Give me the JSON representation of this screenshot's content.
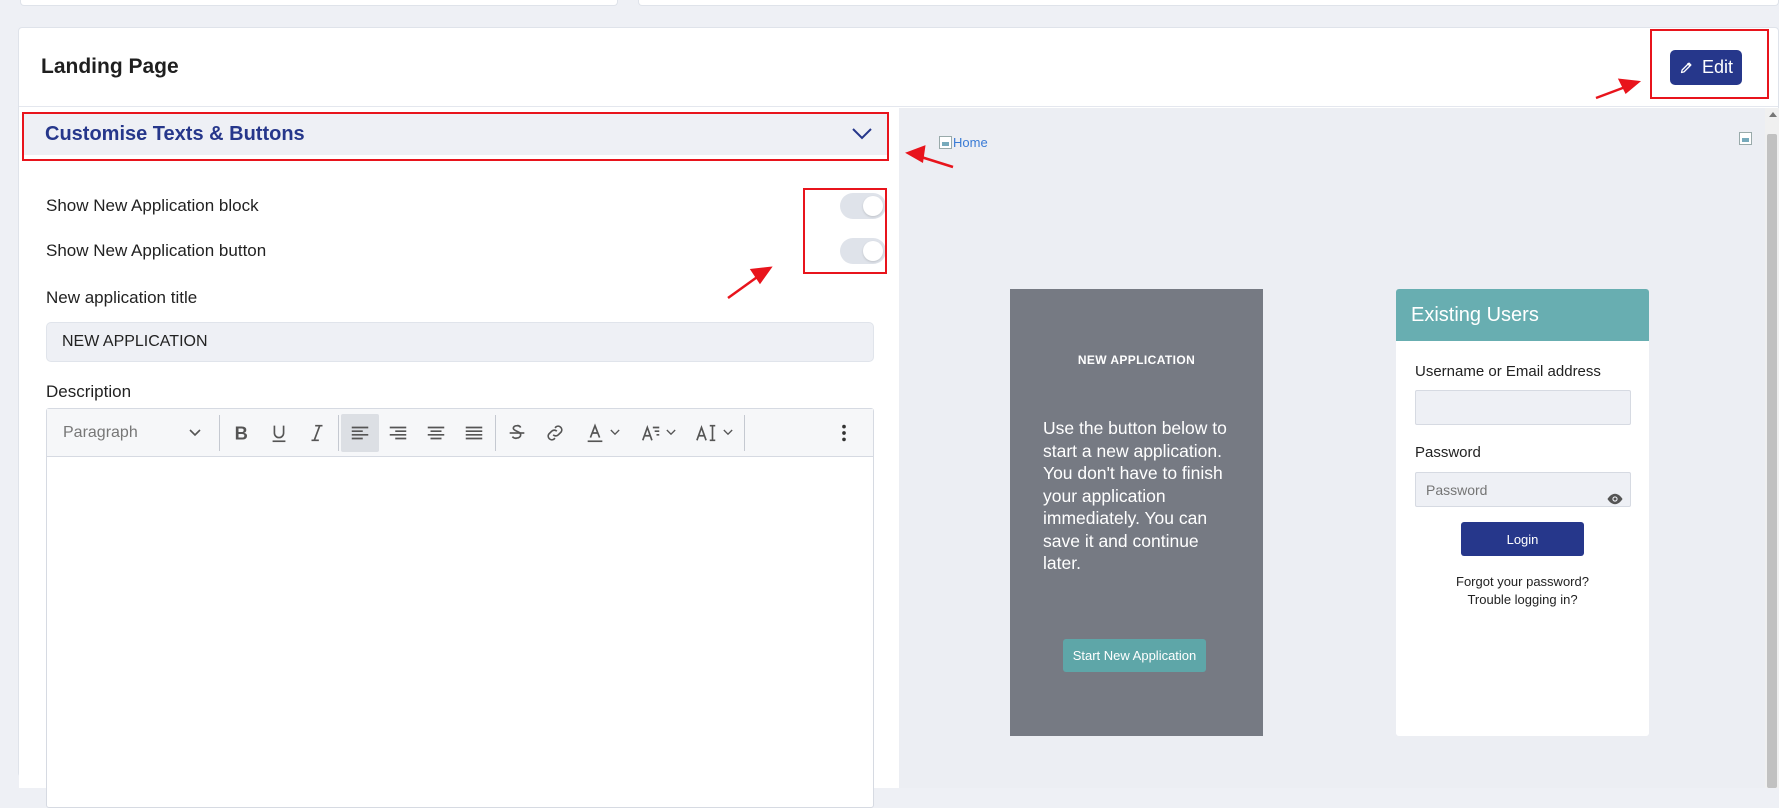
{
  "header": {
    "title": "Landing Page",
    "edit_label": "Edit"
  },
  "customise": {
    "section_title": "Customise Texts & Buttons",
    "toggles": [
      {
        "label": "Show New Application block",
        "state": "off"
      },
      {
        "label": "Show New Application button",
        "state": "off"
      }
    ],
    "title_label": "New application title",
    "title_value": "NEW APPLICATION",
    "description_label": "Description",
    "paragraph_style": "Paragraph"
  },
  "preview": {
    "home_alt": "Home",
    "new_application": {
      "title": "NEW APPLICATION",
      "description": "Use the button below to start a new application. You don't have to finish your application immediately. You can save it and continue later.",
      "button_label": "Start New Application"
    },
    "existing_users": {
      "title": "Existing Users",
      "username_label": "Username or Email address",
      "password_label": "Password",
      "password_placeholder": "Password",
      "login_label": "Login",
      "forgot_link": "Forgot your password?",
      "trouble_link": "Trouble logging in?"
    }
  },
  "colors": {
    "accent": "#26378b",
    "teal": "#68aeb1",
    "new_app_bg": "#767a83",
    "highlight": "#e8141c"
  }
}
